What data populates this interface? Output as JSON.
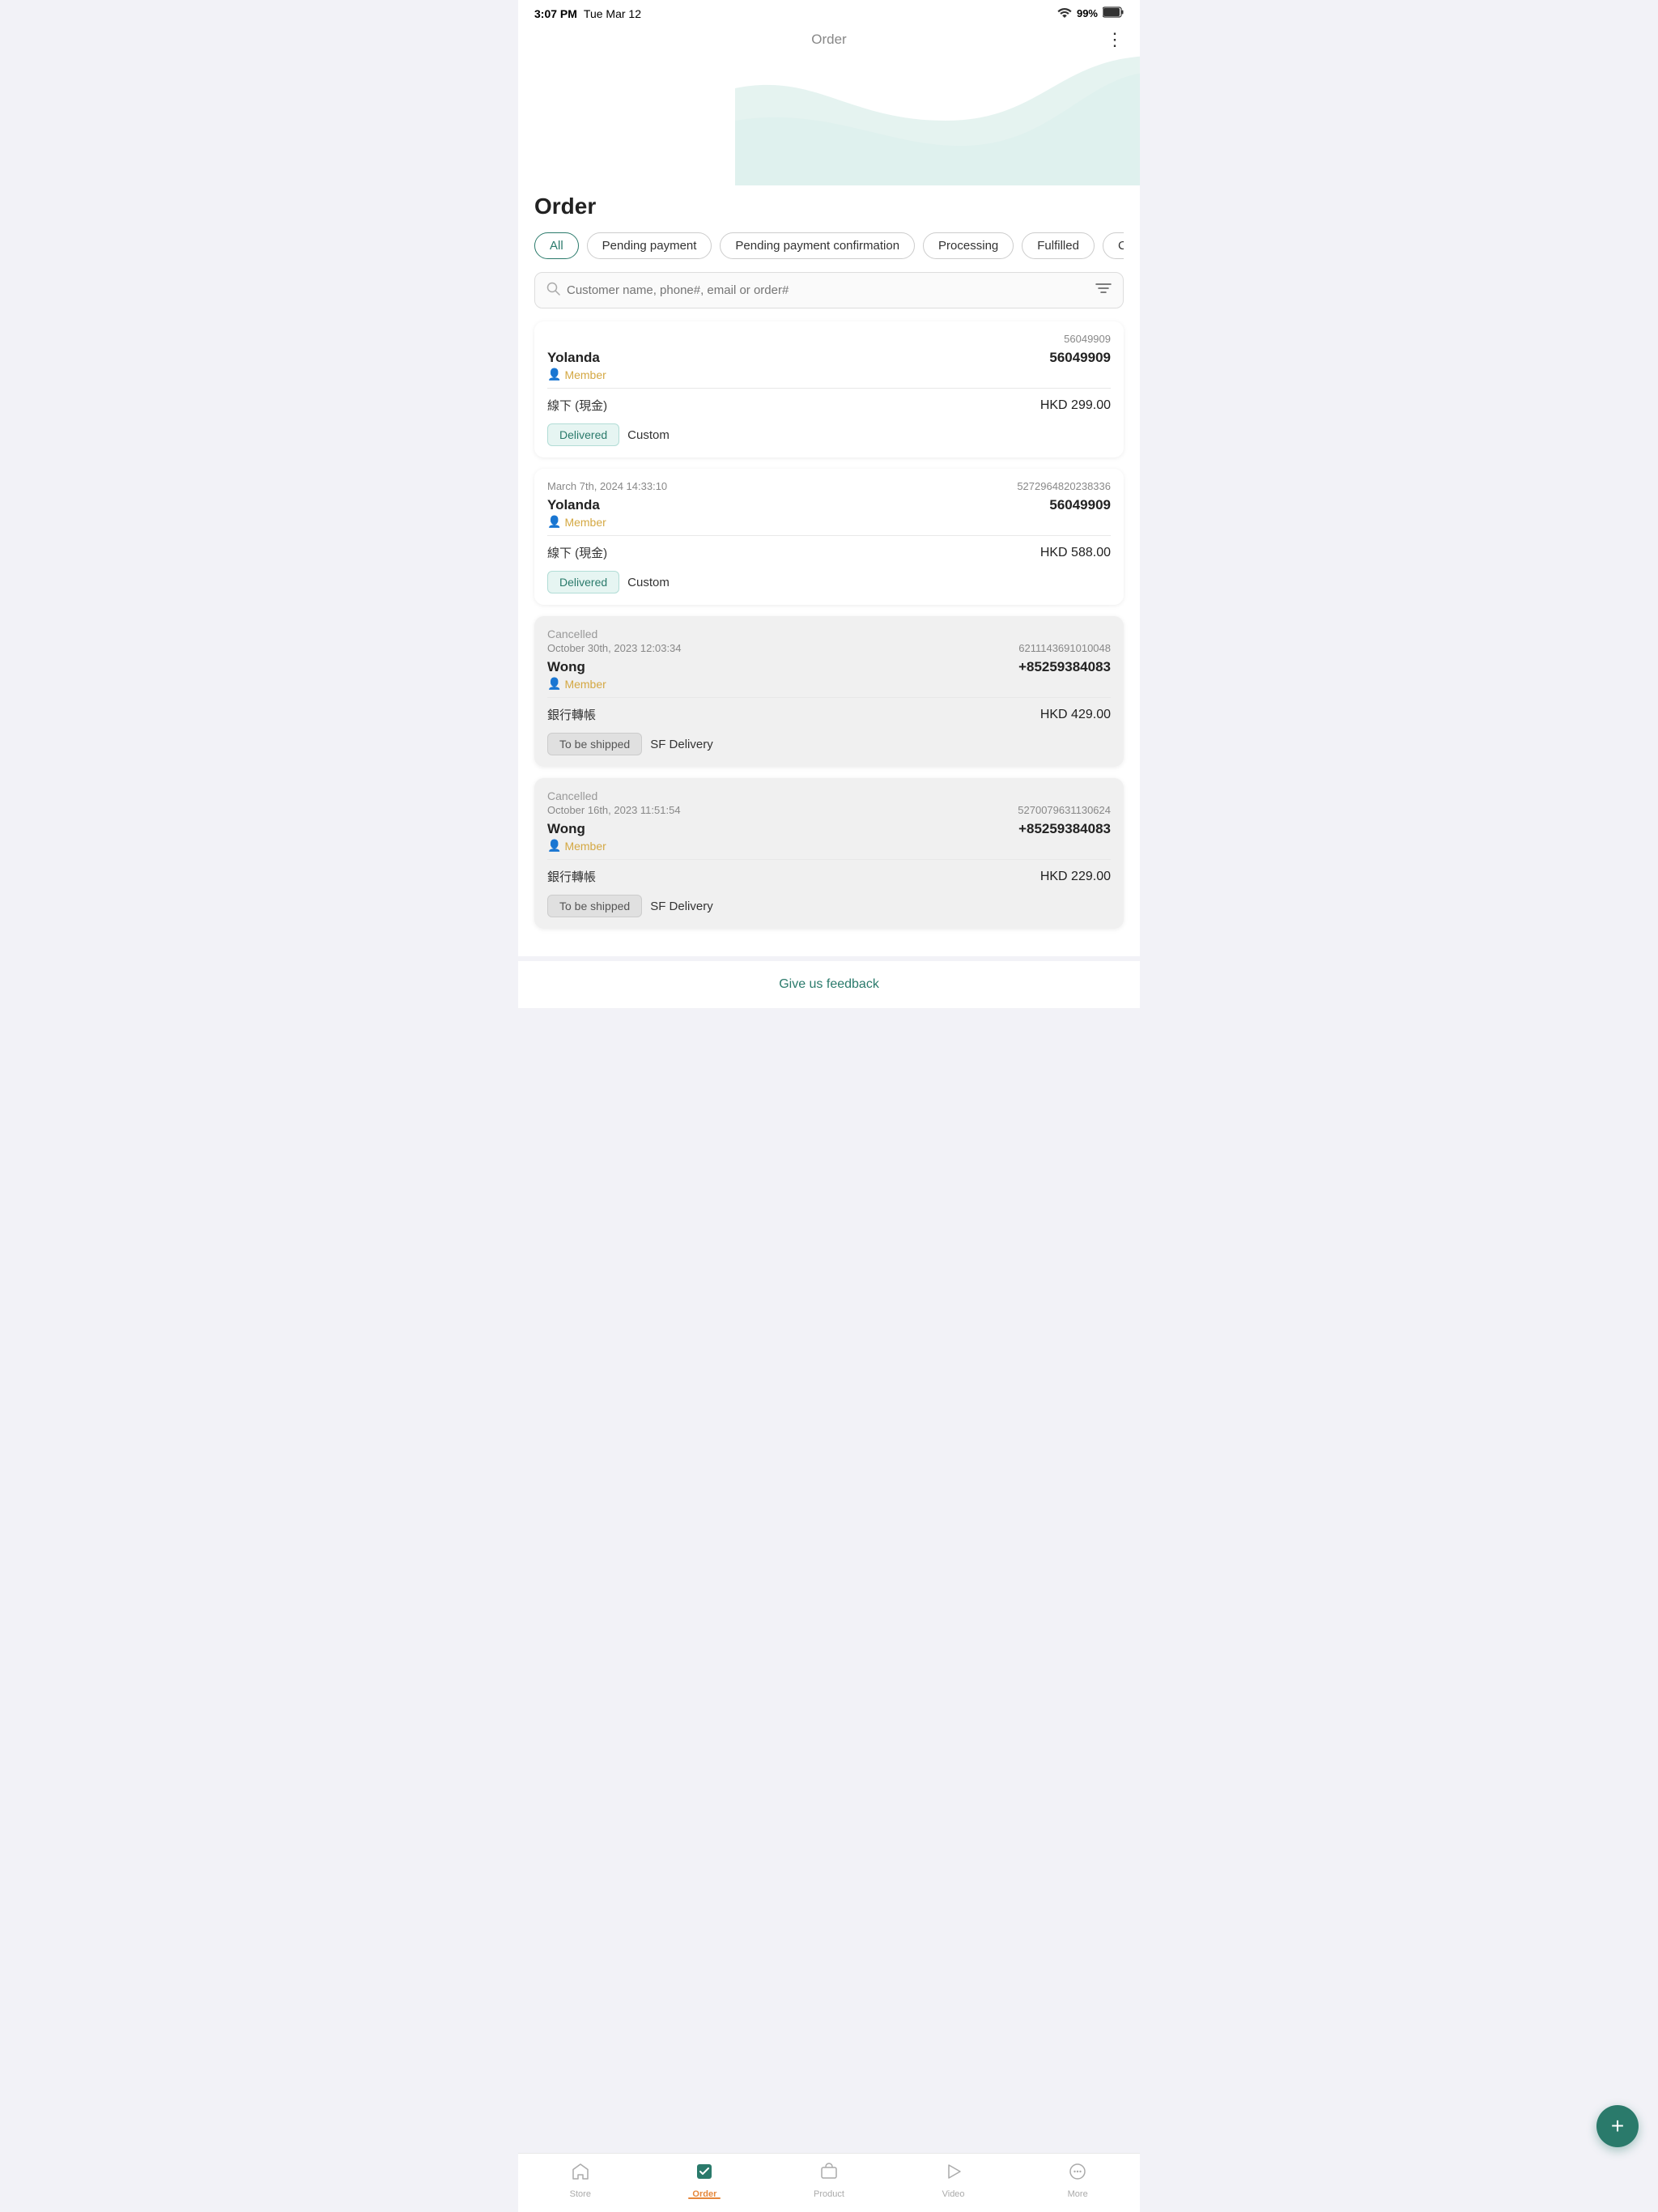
{
  "statusBar": {
    "time": "3:07 PM",
    "date": "Tue Mar 12",
    "battery": "99%",
    "batteryIcon": "🔋",
    "wifiIcon": "📶"
  },
  "header": {
    "title": "Order",
    "menuIcon": "⋮"
  },
  "page": {
    "title": "Order"
  },
  "filters": {
    "tabs": [
      {
        "id": "all",
        "label": "All",
        "active": true
      },
      {
        "id": "pending",
        "label": "Pending payment",
        "active": false
      },
      {
        "id": "pending-confirm",
        "label": "Pending payment confirmation",
        "active": false
      },
      {
        "id": "processing",
        "label": "Processing",
        "active": false
      },
      {
        "id": "fulfilled",
        "label": "Fulfilled",
        "active": false
      },
      {
        "id": "cancelled",
        "label": "Cancelled",
        "active": false
      }
    ]
  },
  "search": {
    "placeholder": "Customer name, phone#, email or order#"
  },
  "orders": [
    {
      "id": 1,
      "cancelled": false,
      "date": "",
      "orderNumber": "56049909",
      "customer": "Yolanda",
      "phone": "56049909",
      "memberLabel": "Member",
      "paymentMethod": "線下 (現金)",
      "amount": "HKD 299.00",
      "tags": [
        {
          "type": "delivered",
          "label": "Delivered"
        },
        {
          "type": "custom",
          "label": "Custom"
        }
      ]
    },
    {
      "id": 2,
      "cancelled": false,
      "date": "March 7th, 2024 14:33:10",
      "orderNumber": "5272964820238336",
      "customer": "Yolanda",
      "phone": "56049909",
      "memberLabel": "Member",
      "paymentMethod": "線下 (現金)",
      "amount": "HKD 588.00",
      "tags": [
        {
          "type": "delivered",
          "label": "Delivered"
        },
        {
          "type": "custom",
          "label": "Custom"
        }
      ]
    },
    {
      "id": 3,
      "cancelled": true,
      "cancelledLabel": "Cancelled",
      "date": "October 30th, 2023 12:03:34",
      "orderNumber": "6211143691010048",
      "customer": "Wong",
      "phone": "+85259384083",
      "memberLabel": "Member",
      "paymentMethod": "銀行轉帳",
      "amount": "HKD 429.00",
      "tags": [
        {
          "type": "to-ship",
          "label": "To be shipped"
        },
        {
          "type": "sf",
          "label": "SF Delivery"
        }
      ]
    },
    {
      "id": 4,
      "cancelled": true,
      "cancelledLabel": "Cancelled",
      "date": "October 16th, 2023 11:51:54",
      "orderNumber": "5270079631130624",
      "customer": "Wong",
      "phone": "+85259384083",
      "memberLabel": "Member",
      "paymentMethod": "銀行轉帳",
      "amount": "HKD 229.00",
      "tags": [
        {
          "type": "to-ship",
          "label": "To be shipped"
        },
        {
          "type": "sf",
          "label": "SF Delivery"
        }
      ]
    }
  ],
  "feedback": {
    "label": "Give us feedback"
  },
  "fab": {
    "icon": "+"
  },
  "bottomNav": {
    "items": [
      {
        "id": "store",
        "icon": "🏠",
        "label": "Store",
        "active": false
      },
      {
        "id": "order",
        "icon": "✅",
        "label": "Order",
        "active": true
      },
      {
        "id": "product",
        "icon": "🏷️",
        "label": "Product",
        "active": false
      },
      {
        "id": "video",
        "icon": "▶️",
        "label": "Video",
        "active": false
      },
      {
        "id": "more",
        "icon": "💬",
        "label": "More",
        "active": false
      }
    ]
  }
}
